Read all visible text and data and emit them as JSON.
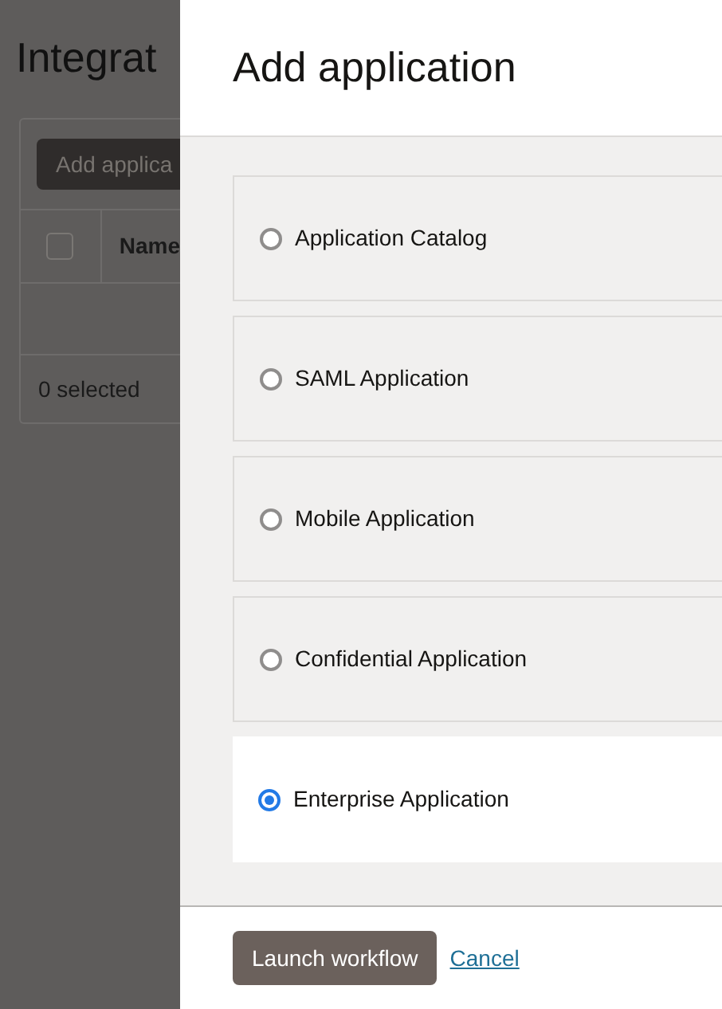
{
  "background_page": {
    "title": "Integrat",
    "add_button": "Add applica",
    "table": {
      "select_all_checked": false,
      "columns": [
        "Name"
      ]
    },
    "status": "0 selected"
  },
  "dialog": {
    "title": "Add application",
    "options": [
      {
        "label": "Application Catalog",
        "selected": false
      },
      {
        "label": "SAML Application",
        "selected": false
      },
      {
        "label": "Mobile Application",
        "selected": false
      },
      {
        "label": "Confidential Application",
        "selected": false
      },
      {
        "label": "Enterprise Application",
        "selected": true
      }
    ],
    "primary_button": "Launch workflow",
    "cancel_link": "Cancel"
  }
}
